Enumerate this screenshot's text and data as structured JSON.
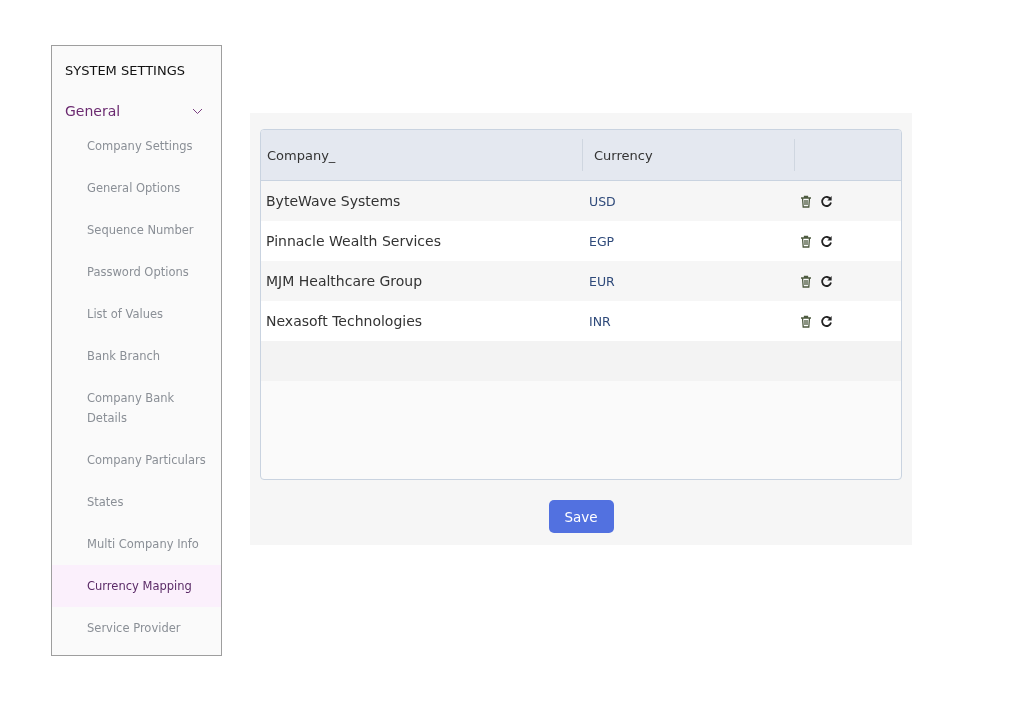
{
  "sidebar": {
    "title": "SYSTEM SETTINGS",
    "group": {
      "label": "General",
      "expanded": true
    },
    "items": [
      {
        "label": "Company Settings",
        "selected": false
      },
      {
        "label": "General Options",
        "selected": false
      },
      {
        "label": "Sequence Number",
        "selected": false
      },
      {
        "label": "Password Options",
        "selected": false
      },
      {
        "label": "List of Values",
        "selected": false
      },
      {
        "label": "Bank Branch",
        "selected": false
      },
      {
        "label": "Company Bank Details",
        "selected": false
      },
      {
        "label": "Company Particulars",
        "selected": false
      },
      {
        "label": "States",
        "selected": false
      },
      {
        "label": "Multi Company Info",
        "selected": false
      },
      {
        "label": "Currency Mapping",
        "selected": true
      },
      {
        "label": "Service Provider",
        "selected": false
      }
    ]
  },
  "table": {
    "columns": [
      "Company_",
      "Currency"
    ],
    "rows": [
      {
        "company": "ByteWave Systems",
        "currency": "USD"
      },
      {
        "company": "Pinnacle Wealth Services",
        "currency": "EGP"
      },
      {
        "company": "MJM Healthcare Group",
        "currency": "EUR"
      },
      {
        "company": "Nexasoft Technologies",
        "currency": "INR"
      }
    ]
  },
  "save_button": "Save"
}
